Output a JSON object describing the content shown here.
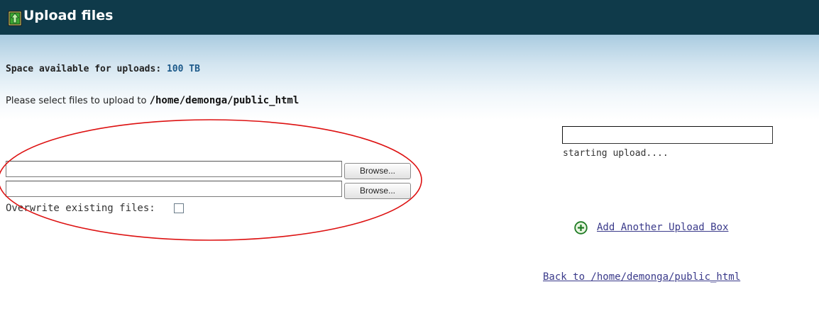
{
  "header": {
    "title": "Upload files",
    "icon": "upload-file-icon",
    "background": "#0f3a4a"
  },
  "space": {
    "label": "Space available for uploads:",
    "value": "100 TB"
  },
  "select": {
    "text": "Please select files to upload to",
    "path": "/home/demonga/public_html"
  },
  "uploads": {
    "browse_label": "Browse...",
    "inputs": [
      {
        "value": ""
      },
      {
        "value": ""
      }
    ],
    "overwrite_label": "Overwrite existing files:",
    "overwrite_checked": false
  },
  "progress": {
    "status": "starting upload...."
  },
  "links": {
    "add_box": "Add Another Upload Box",
    "add_icon": "plus-circle-icon",
    "back": "Back to /home/demonga/public_html"
  },
  "annotation": {
    "color": "#dd1111"
  }
}
